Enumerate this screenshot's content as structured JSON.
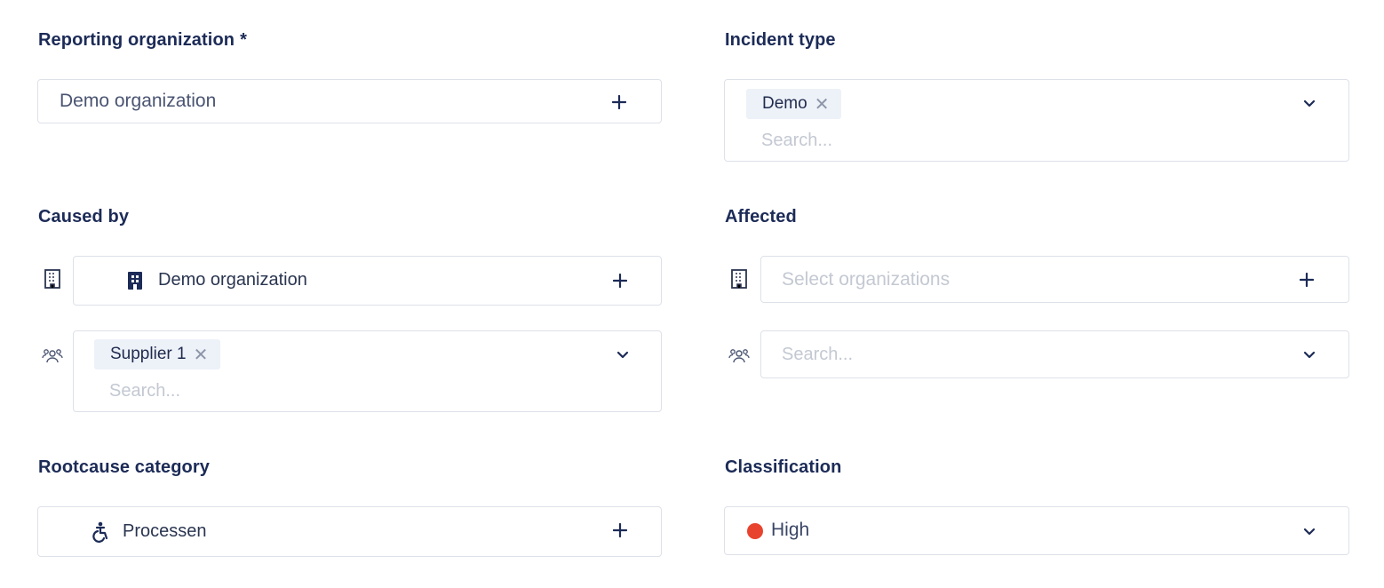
{
  "reporting": {
    "label": "Reporting organization",
    "required_mark": "*",
    "value": "Demo organization"
  },
  "incident_type": {
    "label": "Incident type",
    "tag": "Demo",
    "search_placeholder": "Search..."
  },
  "caused_by": {
    "label": "Caused by",
    "org_value": "Demo organization",
    "tag": "Supplier 1",
    "search_placeholder": "Search..."
  },
  "affected": {
    "label": "Affected",
    "org_placeholder": "Select organizations",
    "search_placeholder": "Search..."
  },
  "rootcause": {
    "label": "Rootcause category",
    "value": "Processen"
  },
  "classification": {
    "label": "Classification",
    "value": "High",
    "dot_color": "#e8432e"
  },
  "icons": {
    "plus": "plus-icon",
    "chevron": "chevron-down-icon",
    "remove": "close-icon",
    "building": "building-icon",
    "group": "people-icon",
    "accessibility": "accessibility-icon"
  }
}
